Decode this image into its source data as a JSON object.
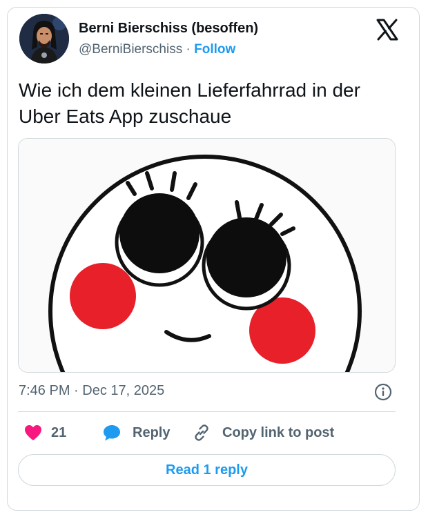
{
  "author": {
    "display_name": "Berni Bierschiss (besoffen)",
    "handle": "@BerniBierschiss",
    "separator": "·",
    "follow_label": "Follow"
  },
  "tweet": {
    "text": "Wie ich dem kleinen Lieferfahrrad in der Uber Eats App zuschaue",
    "time": "7:46 PM",
    "date_separator": "·",
    "date": "Dec 17, 2025"
  },
  "actions": {
    "likes_count": "21",
    "reply_label": "Reply",
    "copy_link_label": "Copy link to post"
  },
  "read_replies_label": "Read 1 reply",
  "icons": {
    "logo": "x-logo-icon",
    "info": "info-icon",
    "like": "heart-icon",
    "reply": "speech-bubble-icon",
    "copy": "link-icon"
  },
  "colors": {
    "accent": "#1d9bf0",
    "like": "#f91880",
    "muted": "#536471",
    "text": "#0f1419",
    "border": "#cfd9de",
    "blush": "#e8202a"
  }
}
